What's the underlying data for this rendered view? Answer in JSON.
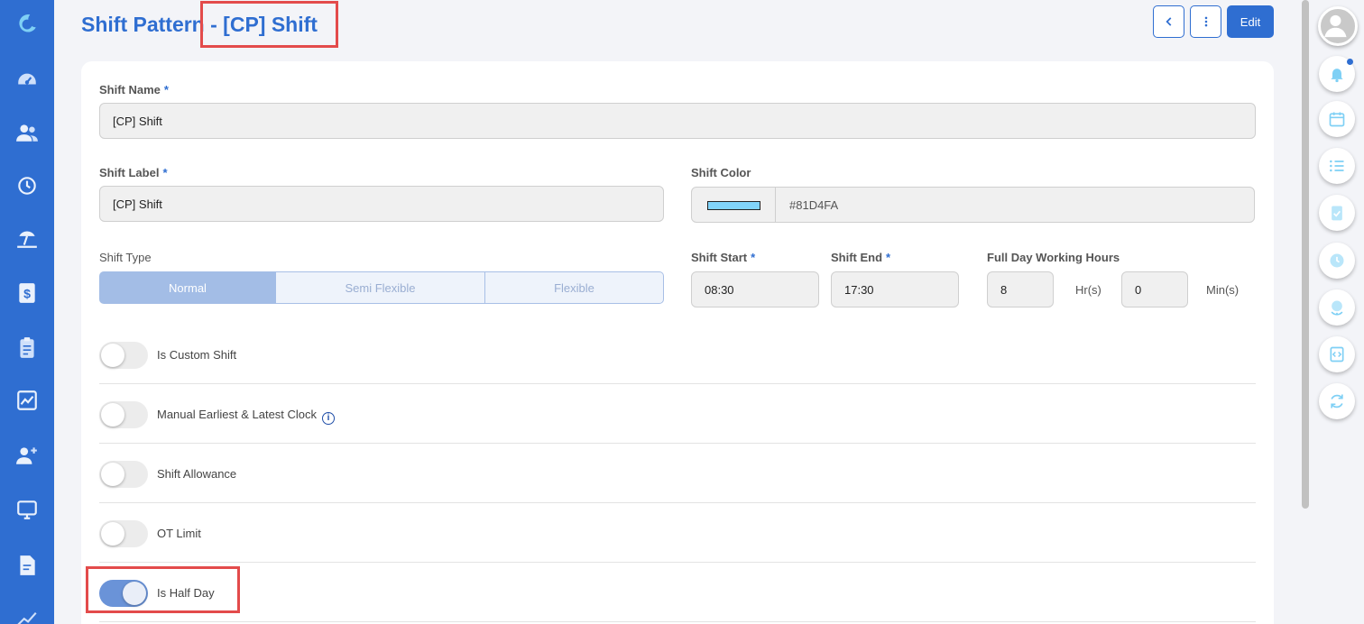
{
  "page": {
    "title_prefix": "Shift Pattern",
    "title_shift": "- [CP] Shift"
  },
  "header": {
    "edit_label": "Edit"
  },
  "form": {
    "shift_name": {
      "label": "Shift Name",
      "required": "*",
      "value": "[CP] Shift"
    },
    "shift_label": {
      "label": "Shift Label",
      "required": "*",
      "value": "[CP] Shift"
    },
    "shift_color": {
      "label": "Shift Color",
      "value": "#81D4FA"
    },
    "shift_type": {
      "label": "Shift Type",
      "options": [
        "Normal",
        "Semi Flexible",
        "Flexible"
      ],
      "selected": "Normal"
    },
    "shift_start": {
      "label": "Shift Start",
      "required": "*",
      "value": "08:30"
    },
    "shift_end": {
      "label": "Shift End",
      "required": "*",
      "value": "17:30"
    },
    "full_day_hours": {
      "label": "Full Day Working Hours",
      "hours": "8",
      "hours_unit": "Hr(s)",
      "minutes": "0",
      "minutes_unit": "Min(s)"
    },
    "toggles": [
      {
        "label": "Is Custom Shift",
        "on": false
      },
      {
        "label": "Manual Earliest & Latest Clock",
        "on": false,
        "info": true
      },
      {
        "label": "Shift Allowance",
        "on": false
      },
      {
        "label": "OT Limit",
        "on": false
      },
      {
        "label": "Is Half Day",
        "on": true
      }
    ]
  },
  "sidebar_icons": [
    "moon-logo-icon",
    "dashboard-icon",
    "people-icon",
    "history-icon",
    "beach-icon",
    "dollar-doc-icon",
    "clipboard-icon",
    "chart-icon",
    "add-user-icon",
    "monitor-icon",
    "document-icon",
    "trend-icon"
  ],
  "rail_icons": [
    "avatar-icon",
    "bell-icon",
    "calendar-icon",
    "list-icon",
    "clipboard-check-icon",
    "clock-icon",
    "globe-icon",
    "code-icon",
    "refresh-icon"
  ],
  "colors": {
    "primary": "#2F6ED1",
    "highlight": "#E34B4B",
    "swatch": "#81D4FA"
  }
}
